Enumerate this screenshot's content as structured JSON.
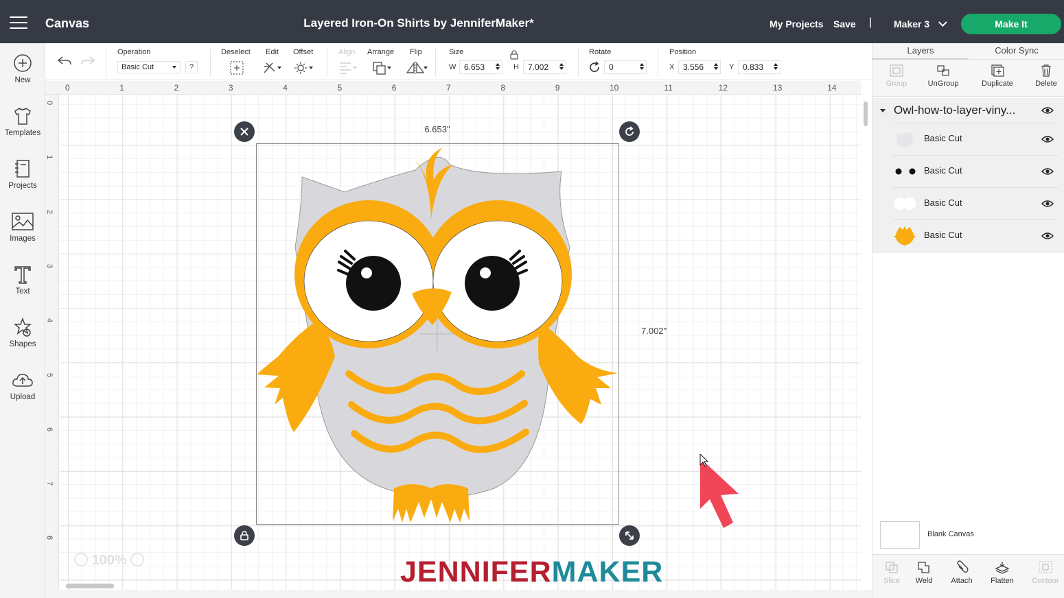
{
  "topbar": {
    "app_title": "Canvas",
    "doc_title": "Layered Iron-On Shirts by JenniferMaker*",
    "my_projects": "My Projects",
    "save": "Save",
    "divider": "|",
    "machine": "Maker 3",
    "make_it": "Make It"
  },
  "sidebar": {
    "items": [
      {
        "label": "New",
        "icon": "plus-circle-icon"
      },
      {
        "label": "Templates",
        "icon": "tshirt-icon"
      },
      {
        "label": "Projects",
        "icon": "notebook-icon"
      },
      {
        "label": "Images",
        "icon": "image-icon"
      },
      {
        "label": "Text",
        "icon": "text-t-icon"
      },
      {
        "label": "Shapes",
        "icon": "shapes-icon"
      },
      {
        "label": "Upload",
        "icon": "cloud-upload-icon"
      }
    ]
  },
  "toolbar": {
    "operation_label": "Operation",
    "operation_value": "Basic Cut",
    "help": "?",
    "deselect": "Deselect",
    "edit": "Edit",
    "offset": "Offset",
    "align": "Align",
    "arrange": "Arrange",
    "flip": "Flip",
    "size_label": "Size",
    "w_prefix": "W",
    "w_value": "6.653",
    "h_prefix": "H",
    "h_value": "7.002",
    "rotate_label": "Rotate",
    "rotate_value": "0",
    "position_label": "Position",
    "x_prefix": "X",
    "x_value": "3.556",
    "y_prefix": "Y",
    "y_value": "0.833"
  },
  "ruler": {
    "top": [
      "0",
      "1",
      "2",
      "3",
      "4",
      "5",
      "6",
      "7",
      "8",
      "9",
      "10",
      "11",
      "12",
      "13",
      "14"
    ],
    "left": [
      "0",
      "1",
      "2",
      "3",
      "4",
      "5",
      "6",
      "7",
      "8"
    ]
  },
  "canvas": {
    "width_dim": "6.653\"",
    "height_dim": "7.002\"",
    "zoom_minus": "−",
    "zoom": "100%",
    "zoom_plus": "+",
    "brand_part1": "JENNIFER",
    "brand_part2": "MAKER"
  },
  "panel": {
    "tabs": {
      "layers": "Layers",
      "color_sync": "Color Sync"
    },
    "actions": {
      "group": "Group",
      "ungroup": "UnGroup",
      "duplicate": "Duplicate",
      "delete": "Delete"
    },
    "group_name": "Owl-how-to-layer-viny...",
    "layers": [
      {
        "name": "Basic Cut",
        "thumb": "gray-body"
      },
      {
        "name": "Basic Cut",
        "thumb": "black-pupils"
      },
      {
        "name": "Basic Cut",
        "thumb": "white-eyes"
      },
      {
        "name": "Basic Cut",
        "thumb": "yellow-owl"
      }
    ],
    "blank_canvas": "Blank Canvas",
    "bottom": {
      "slice": "Slice",
      "weld": "Weld",
      "attach": "Attach",
      "flatten": "Flatten",
      "contour": "Contour"
    }
  },
  "colors": {
    "topbar": "#363a45",
    "make_it": "#17a96a",
    "owl_yellow": "#f9ab10",
    "owl_gray": "#d8d8dc",
    "cursor_red": "#f0364a",
    "brand_red": "#b61f30",
    "brand_teal": "#1f8a99"
  }
}
